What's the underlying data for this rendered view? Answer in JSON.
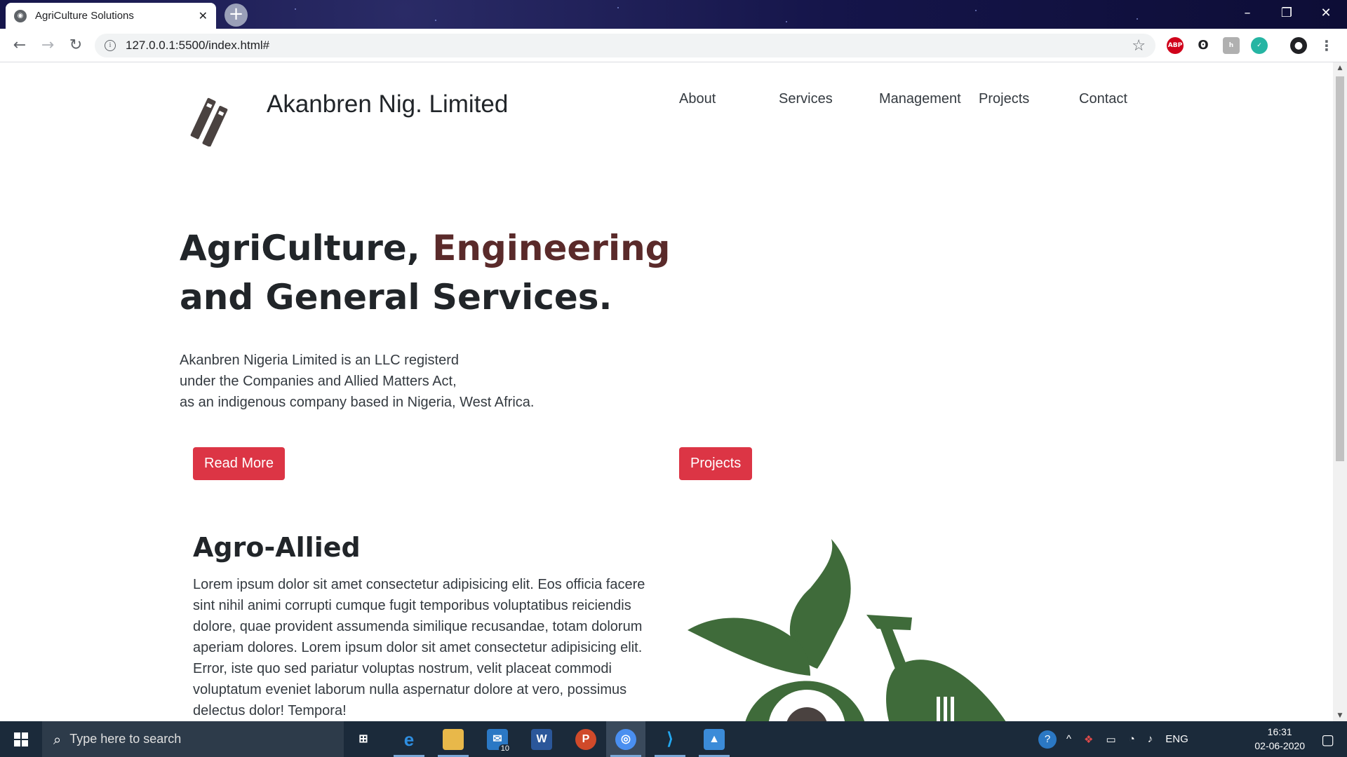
{
  "browser": {
    "tab_title": "AgriCulture Solutions",
    "url": "127.0.0.1:5500/index.html#"
  },
  "header": {
    "brand_name": "Akanbren Nig. Limited",
    "nav": [
      "About",
      "Services",
      "Management",
      "Projects",
      "Contact"
    ]
  },
  "hero": {
    "title_part1": "AgriCulture, ",
    "title_accent": "Engineering",
    "title_line2": "and General Services.",
    "desc_lines": [
      "Akanbren Nigeria Limited is an LLC registerd",
      "under the Companies and Allied Matters Act,",
      "as an indigenous company based in Nigeria, West Africa."
    ],
    "btn_read_more": "Read More",
    "btn_projects": "Projects"
  },
  "section": {
    "title": "Agro-Allied",
    "text": "Lorem ipsum dolor sit amet consectetur adipisicing elit. Eos officia facere sint nihil animi corrupti cumque fugit temporibus voluptatibus reiciendis dolore, quae provident assumenda similique recusandae, totam dolorum aperiam dolores. Lorem ipsum dolor sit amet consectetur adipisicing elit. Error, iste quo sed pariatur voluptas nostrum, velit placeat commodi voluptatum eveniet laborum nulla aspernatur dolore at vero, possimus delectus dolor! Tempora!"
  },
  "taskbar": {
    "search_placeholder": "Type here to search",
    "mail_badge": "10",
    "lang": "ENG",
    "time": "16:31",
    "date": "02-06-2020"
  },
  "colors": {
    "accent_red": "#dc3545",
    "accent_brown": "#5a2a2a",
    "leaf_green": "#3f6b3a"
  }
}
